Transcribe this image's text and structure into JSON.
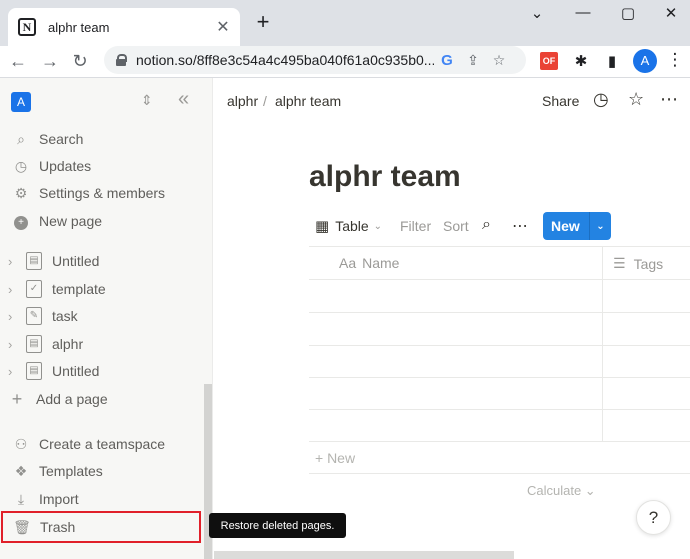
{
  "browser": {
    "tab_title": "alphr team",
    "tab_favicon": "N",
    "tab_close": "✕",
    "new_tab": "+",
    "window_controls": [
      "⌄",
      "—",
      "▢",
      "✕"
    ],
    "nav": {
      "back": "←",
      "forward": "→",
      "reload": "↻"
    },
    "url": "notion.so/8ff8e3c54a4c495ba040f61a0c935b0...",
    "omnibox_icons": [
      "G",
      "⇪",
      "☆"
    ],
    "extension_label": "OF",
    "extensions": [
      "✱",
      "▮"
    ],
    "profile_initial": "A",
    "menu": "⋮"
  },
  "sidebar": {
    "workspace_initial": "A",
    "switch_icon": "⇕",
    "collapse_icon": "«",
    "top_items": [
      {
        "label": "Search",
        "icon": "⌕"
      },
      {
        "label": "Updates",
        "icon": "◷"
      },
      {
        "label": "Settings & members",
        "icon": "⚙"
      },
      {
        "label": "New page",
        "icon": "+"
      }
    ],
    "pages": [
      {
        "label": "Untitled",
        "icon": "▤"
      },
      {
        "label": "template",
        "icon": "✓"
      },
      {
        "label": "task",
        "icon": "✎"
      },
      {
        "label": "alphr",
        "icon": "▤"
      },
      {
        "label": "Untitled",
        "icon": "▤"
      }
    ],
    "chevron": "›",
    "add_page": "Add a page",
    "add_page_icon": "+",
    "bottom_items": [
      {
        "label": "Create a teamspace",
        "icon": "⚇"
      },
      {
        "label": "Templates",
        "icon": "❖"
      },
      {
        "label": "Import",
        "icon": "⤓"
      }
    ],
    "trash": {
      "label": "Trash",
      "icon": "🗑"
    }
  },
  "tooltip": "Restore deleted pages.",
  "topbar": {
    "breadcrumb_parent": "alphr",
    "breadcrumb_sep": "/",
    "breadcrumb_current": "alphr team",
    "share": "Share",
    "icons": [
      "◷",
      "☆",
      "⋯"
    ]
  },
  "page": {
    "title": "alphr team",
    "view_label": "Table",
    "view_icon": "▦",
    "view_chevron": "⌄",
    "filter": "Filter",
    "sort": "Sort",
    "search_icon": "⌕",
    "more_icon": "⋯",
    "new_button": "New",
    "new_dropdown": "⌄",
    "columns": [
      {
        "icon": "Aa",
        "label": "Name"
      },
      {
        "icon": "☰",
        "label": "Tags"
      }
    ],
    "add_row": "+ New",
    "calculate": "Calculate ⌄",
    "help": "?"
  }
}
